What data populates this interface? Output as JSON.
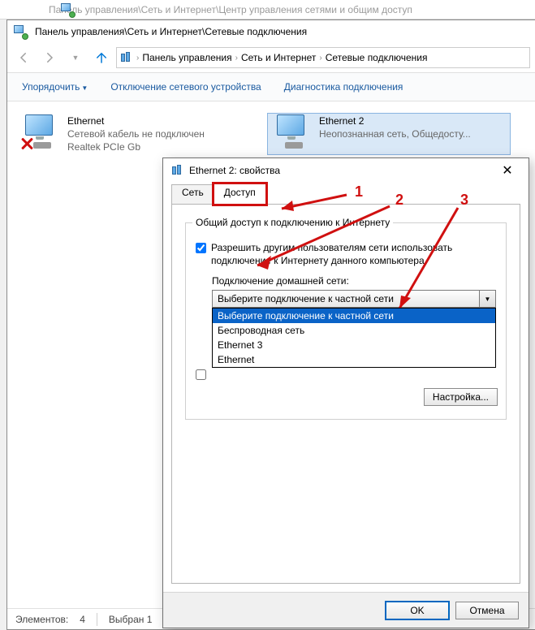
{
  "bg_window_title": "Панель управления\\Сеть и Интернет\\Центр управления сетями и общим доступ",
  "explorer": {
    "title": "Панель управления\\Сеть и Интернет\\Сетевые подключения",
    "bc1": "Панель управления",
    "bc2": "Сеть и Интернет",
    "bc3": "Сетевые подключения",
    "toolbar": {
      "organize": "Упорядочить",
      "disable": "Отключение сетевого устройства",
      "diag": "Диагностика подключения"
    },
    "adapters": [
      {
        "name": "Ethernet",
        "line2": "Сетевой кабель не подключен",
        "line3": "Realtek PCIe Gb"
      },
      {
        "name": "Ethernet 2",
        "line2": "Неопознанная сеть, Общедосту..."
      }
    ],
    "status_count_label": "Элементов:",
    "status_count_value": "4",
    "status_sel_label": "Выбран 1"
  },
  "dialog": {
    "title": "Ethernet 2: свойства",
    "tabs": {
      "net": "Сеть",
      "access": "Доступ"
    },
    "group_legend": "Общий доступ к подключению к Интернету",
    "chk_allow": "Разрешить другим пользователям сети использовать подключение к Интернету данного компьютера",
    "home_net_label": "Подключение домашней сети:",
    "combo_text": "Выберите подключение к частной сети",
    "combo_options": [
      "Выберите подключение к частной сети",
      "Беспроводная сеть",
      "Ethernet 3",
      "Ethernet"
    ],
    "chk_manage_stub": "",
    "settings_btn": "Настройка...",
    "ok": "OK",
    "cancel": "Отмена"
  },
  "anno": {
    "n1": "1",
    "n2": "2",
    "n3": "3"
  }
}
